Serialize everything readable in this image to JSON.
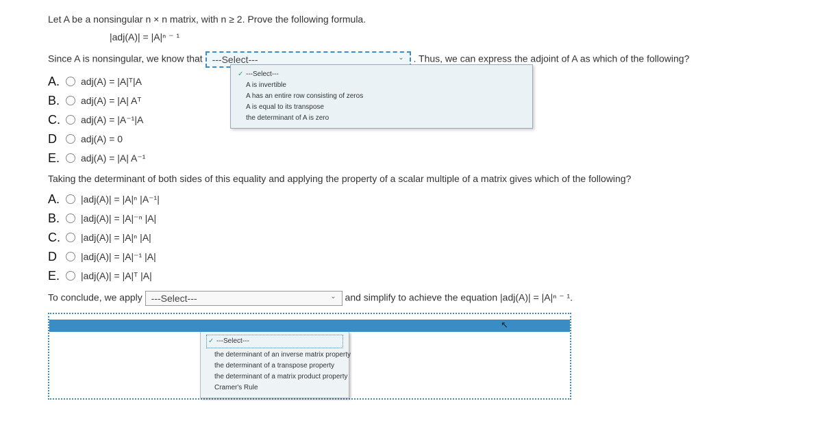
{
  "problem": {
    "intro": "Let A be a nonsingular n × n matrix, with n ≥ 2. Prove the following formula.",
    "formula": "|adj(A)| = |A|ⁿ ⁻ ¹"
  },
  "step1": {
    "prefix": "Since A is nonsingular, we know that",
    "select_placeholder": "---Select---",
    "suffix": ". Thus, we can express the adjoint of A as which of the following?",
    "dropdown": {
      "placeholder": "---Select---",
      "opt1": "A is invertible",
      "opt2": "A has an entire row consisting of zeros",
      "opt3": "A is equal to its transpose",
      "opt4": "the determinant of A is zero"
    }
  },
  "options1": {
    "A": "adj(A) = |A|ᵀ|A",
    "B": "adj(A) = |A| Aᵀ",
    "C": "adj(A) = |A⁻¹|A",
    "D": "adj(A) = 0",
    "E": "adj(A) = |A| A⁻¹"
  },
  "step2": {
    "intro": "Taking the determinant of both sides of this equality and applying the property of a scalar multiple of a matrix gives which of the following?"
  },
  "options2": {
    "A": "|adj(A)| = |A|ⁿ |A⁻¹|",
    "B": "|adj(A)| = |A|⁻ⁿ |A|",
    "C": "|adj(A)| = |A|ⁿ |A|",
    "D": "|adj(A)| = |A|⁻¹ |A|",
    "E": "|adj(A)| = |A|ᵀ |A|"
  },
  "step3": {
    "prefix": "To conclude, we apply",
    "select_placeholder": "---Select---",
    "suffix": " and simplify to achieve the equation |adj(A)| = |A|ⁿ ⁻ ¹.",
    "dropdown": {
      "placeholder": "---Select---",
      "opt1": "the determinant of an inverse matrix property",
      "opt2": "the determinant of a transpose property",
      "opt3": "the determinant of a matrix product property",
      "opt4": "Cramer's Rule"
    }
  },
  "labels": {
    "A": "A.",
    "B": "B.",
    "C": "C.",
    "D": "D",
    "E": "E."
  }
}
